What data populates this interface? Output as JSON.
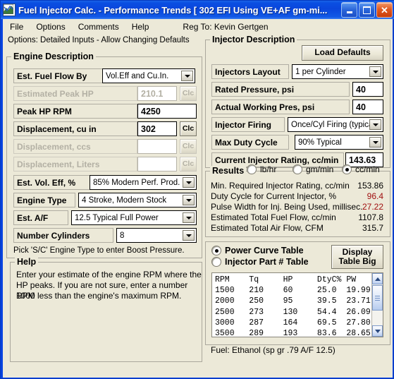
{
  "window": {
    "title": "Fuel Injector Calc. - Performance Trends  [ 302 EFI Using VE+AF gm-mi...",
    "icon": "app-icon",
    "minimize": "_",
    "maximize": "□",
    "close": "✕"
  },
  "menu": {
    "items": [
      "File",
      "Options",
      "Comments",
      "Help"
    ],
    "registration": "Reg To: Kevin Gertgen"
  },
  "options_line": "Options: Detailed Inputs - Allow Changing Defaults",
  "engine": {
    "legend": "Engine Description",
    "fuel_flow_by": {
      "label": "Est. Fuel Flow By",
      "value": "Vol.Eff and Cu.In."
    },
    "estimated_peak_hp": {
      "label": "Estimated Peak HP",
      "value": "210.1",
      "calc": "Clc"
    },
    "peak_hp_rpm": {
      "label": "Peak HP RPM",
      "value": "4250"
    },
    "displacement_cu_in": {
      "label": "Displacement, cu in",
      "value": "302",
      "calc": "Clc"
    },
    "displacement_ccs": {
      "label": "Displacement, ccs",
      "value": "",
      "calc": "Clc"
    },
    "displacement_liters": {
      "label": "Displacement, Liters",
      "value": "",
      "calc": "Clc"
    },
    "vol_eff": {
      "label": "Est. Vol. Eff, %",
      "value": "85% Modern Perf. Prod."
    },
    "engine_type": {
      "label": "Engine Type",
      "value": "4 Stroke, Modern Stock"
    },
    "air_fuel": {
      "label": "Est. A/F",
      "value": "12.5 Typical Full Power"
    },
    "num_cylinders": {
      "label": "Number Cylinders",
      "value": "8"
    },
    "note": "Pick 'S/C' Engine Type to enter Boost Pressure."
  },
  "help": {
    "legend": "Help",
    "line1": "Enter your estimate of the engine RPM where the",
    "line2": "HP peaks.  If you are not sure, enter a number 1000",
    "line3": "RPM less than the engine's maximum RPM."
  },
  "injector": {
    "legend": "Injector Description",
    "load_defaults": "Load Defaults",
    "layout": {
      "label": "Injectors Layout",
      "value": "1 per Cylinder"
    },
    "rated_pressure": {
      "label": "Rated Pressure, psi",
      "value": "40"
    },
    "actual_pressure": {
      "label": "Actual Working Pres, psi",
      "value": "40"
    },
    "firing": {
      "label": "Injector Firing",
      "value": "Once/Cyl Firing (typical)"
    },
    "max_duty_cycle": {
      "label": "Max Duty Cycle",
      "value": "90% Typical"
    },
    "current_rating": {
      "label": "Current Injector Rating, cc/min",
      "value": "143.63"
    }
  },
  "results": {
    "legend": "Results",
    "units": [
      {
        "label": "lb/hr",
        "selected": false
      },
      {
        "label": "gm/min",
        "selected": false
      },
      {
        "label": "cc/min",
        "selected": true
      }
    ],
    "rows": [
      {
        "label": "Min. Required Injector Rating, cc/min",
        "value": "153.86",
        "red": false
      },
      {
        "label": "Duty Cycle for Current Injector, %",
        "value": "96.4",
        "red": true
      },
      {
        "label": "Pulse Width for Inj. Being Used, millisec.",
        "value": "27.22",
        "red": true
      },
      {
        "label": "Estimated Total Fuel Flow, cc/min",
        "value": "1107.8",
        "red": false
      },
      {
        "label": "Estimated Total Air Flow, CFM",
        "value": "315.7",
        "red": false
      }
    ]
  },
  "table_section": {
    "mode_options": [
      {
        "label": "Power Curve Table",
        "selected": true
      },
      {
        "label": "Injector Part # Table",
        "selected": false
      }
    ],
    "display_button_line1": "Display",
    "display_button_line2": "Table Big",
    "columns": [
      "RPM",
      "Tq",
      "HP",
      "DtyC%",
      "PW"
    ],
    "rows": [
      [
        "1500",
        "210",
        "60",
        "25.0",
        "19.99"
      ],
      [
        "2000",
        "250",
        "95",
        "39.5",
        "23.71"
      ],
      [
        "2500",
        "273",
        "130",
        "54.4",
        "26.09"
      ],
      [
        "3000",
        "287",
        "164",
        "69.5",
        "27.80"
      ],
      [
        "3500",
        "289",
        "193",
        "83.6",
        "28.65"
      ]
    ],
    "table_text": "RPM    Tq     HP     DtyC% PW\n1500   210    60     25.0  19.99\n2000   250    95     39.5  23.71\n2500   273    130    54.4  26.09\n3000   287    164    69.5  27.80\n3500   289    193    83.6  28.65",
    "fuel_line": "Fuel: Ethanol  (sp gr .79  A/F 12.5)"
  },
  "colors": {
    "title_blue": "#0a46dc",
    "face": "#ece9d8",
    "alert_red": "#a01010"
  }
}
